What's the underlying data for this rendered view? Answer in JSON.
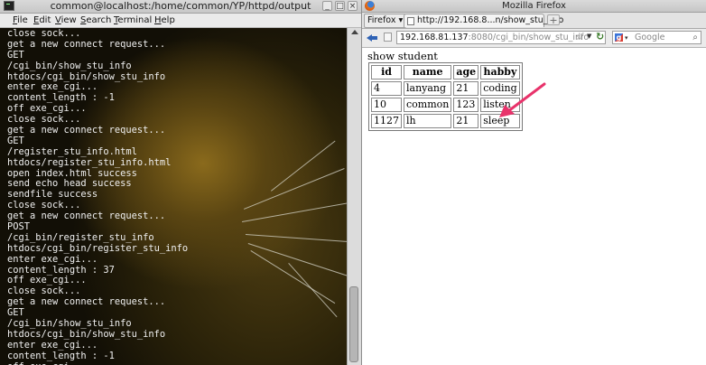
{
  "terminal": {
    "title": "common@localhost:/home/common/YP/httpd/output",
    "window_buttons": [
      "_",
      "□",
      "×"
    ],
    "menu": [
      "File",
      "Edit",
      "View",
      "Search",
      "Terminal",
      "Help"
    ],
    "lines": [
      "close sock...",
      "get a new connect request...",
      "GET",
      "/cgi_bin/show_stu_info",
      "htdocs/cgi_bin/show_stu_info",
      "enter exe_cgi...",
      "content_length : -1",
      "off exe_cgi...",
      "close sock...",
      "get a new connect request...",
      "GET",
      "/register_stu_info.html",
      "htdocs/register_stu_info.html",
      "open index.html success",
      "send echo head success",
      "sendfile success",
      "close sock...",
      "get a new connect request...",
      "POST",
      "/cgi_bin/register_stu_info",
      "htdocs/cgi_bin/register_stu_info",
      "enter exe_cgi...",
      "content_length : 37",
      "off exe_cgi...",
      "close sock...",
      "get a new connect request...",
      "GET",
      "/cgi_bin/show_stu_info",
      "htdocs/cgi_bin/show_stu_info",
      "enter exe_cgi...",
      "content_length : -1",
      "off exe_cgi..."
    ]
  },
  "browser": {
    "title": "Mozilla Firefox",
    "menu_button": "Firefox",
    "tab_label": "http://192.168.8...n/show_stu_info",
    "url_host": "192.168.81.137",
    "url_rest": ":8080/cgi_bin/show_stu_info",
    "search_placeholder": "Google",
    "page_heading": "show student",
    "table": {
      "headers": [
        "id",
        "name",
        "age",
        "habby"
      ],
      "rows": [
        [
          "4",
          "lanyang",
          "21",
          "coding"
        ],
        [
          "10",
          "common",
          "123",
          "listen"
        ],
        [
          "1127",
          "lh",
          "21",
          "sleep"
        ]
      ]
    }
  },
  "colors": {
    "terminal_text": "#f0f0f0",
    "annotation_arrow": "#e8336b",
    "back_arrow": "#2e62b5"
  },
  "icons": {
    "terminal_app": "terminal-icon",
    "browser_app": "firefox-logo-icon",
    "back": "back-arrow-icon",
    "reload": "reload-icon",
    "bookmark": "star-icon",
    "search_engine": "google-icon",
    "new_tab": "plus-icon"
  }
}
